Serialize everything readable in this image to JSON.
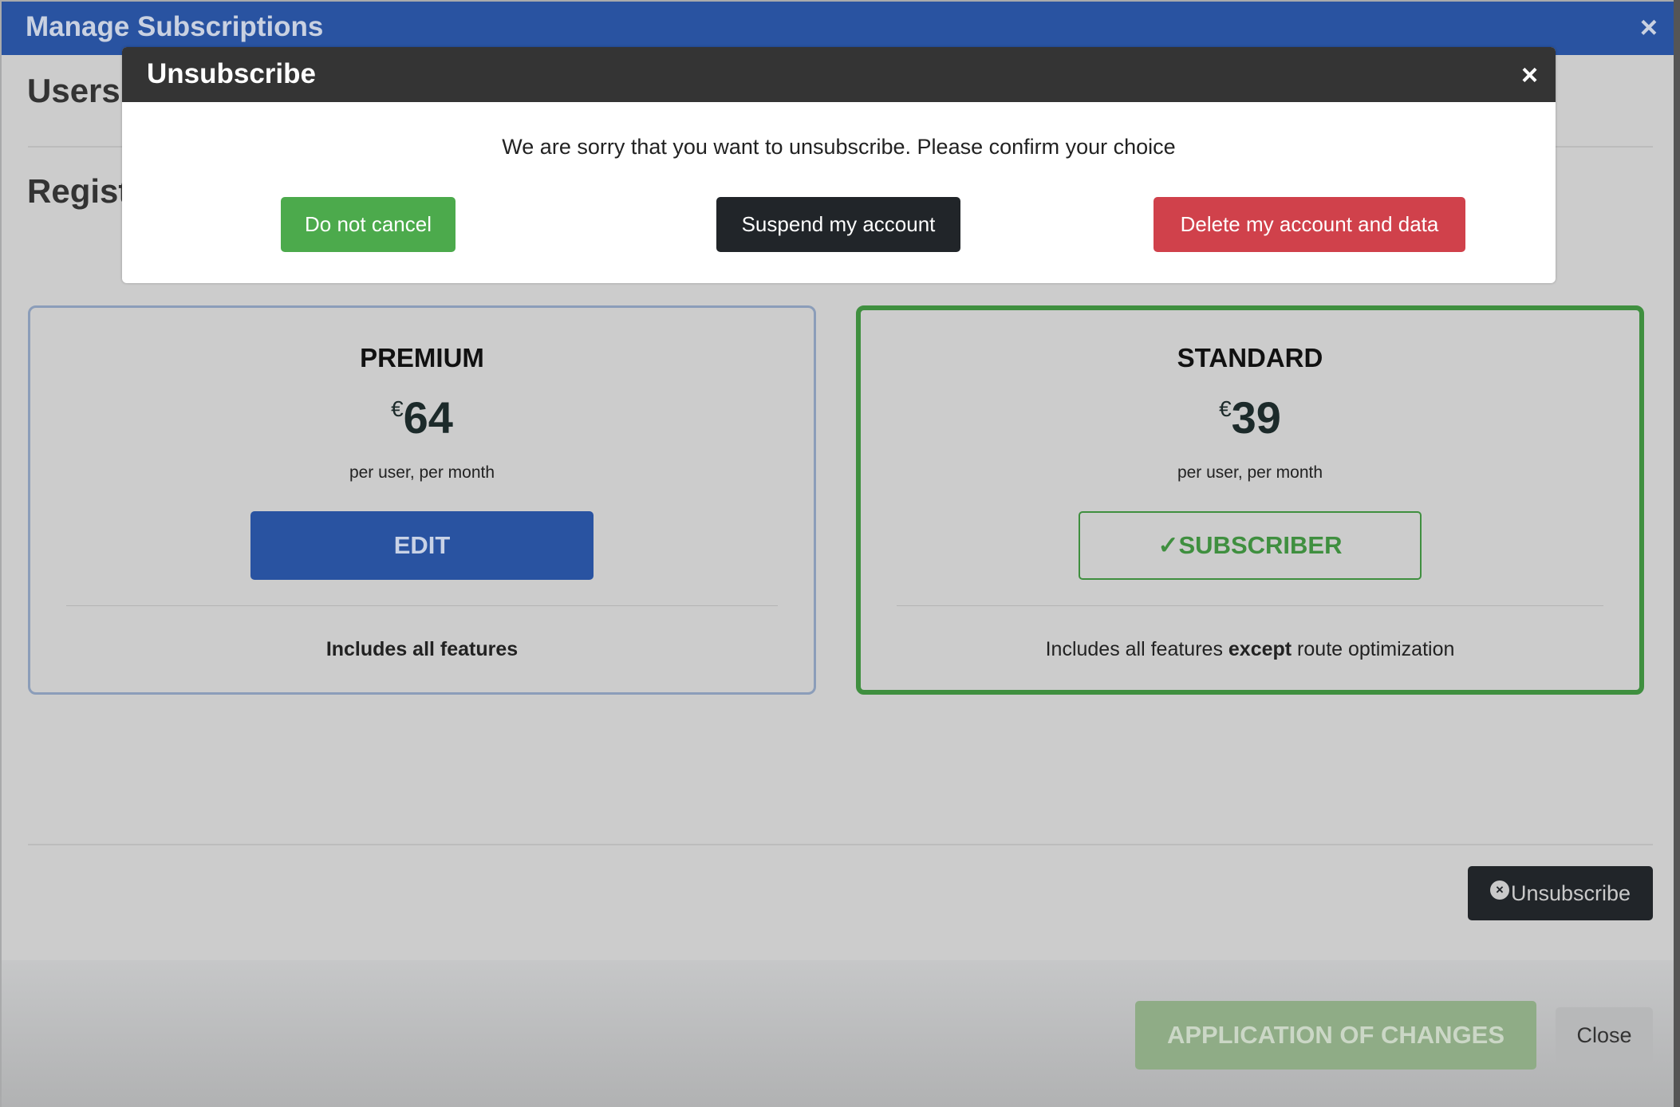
{
  "main_dialog": {
    "title": "Manage Subscriptions",
    "close_label": "×",
    "heading_users": "Users",
    "heading_regist": "Regist"
  },
  "plans": [
    {
      "name": "PREMIUM",
      "currency": "€",
      "price": "64",
      "period": "per user, per month",
      "button_label": "EDIT",
      "features_bold": "Includes all features"
    },
    {
      "name": "STANDARD",
      "currency": "€",
      "price": "39",
      "period": "per user, per month",
      "button_check": "✓",
      "button_label": "SUBSCRIBER",
      "features_pre": "Includes all features ",
      "features_bold": "except",
      "features_post": " route optimization",
      "status": "current"
    }
  ],
  "unsubscribe_button": {
    "icon": "x-circle-icon",
    "glyph": "×",
    "label": "Unsubscribe"
  },
  "footer": {
    "apply_label": "APPLICATION OF CHANGES",
    "close_label": "Close"
  },
  "modal": {
    "title": "Unsubscribe",
    "close_label": "×",
    "message": "We are sorry that you want to unsubscribe. Please confirm your choice",
    "buttons": {
      "keep": "Do not cancel",
      "suspend": "Suspend my account",
      "delete": "Delete my account and data"
    }
  },
  "colors": {
    "primary": "#2953a1",
    "success": "#4caa4c",
    "dark": "#212529",
    "danger": "#d0414b"
  }
}
